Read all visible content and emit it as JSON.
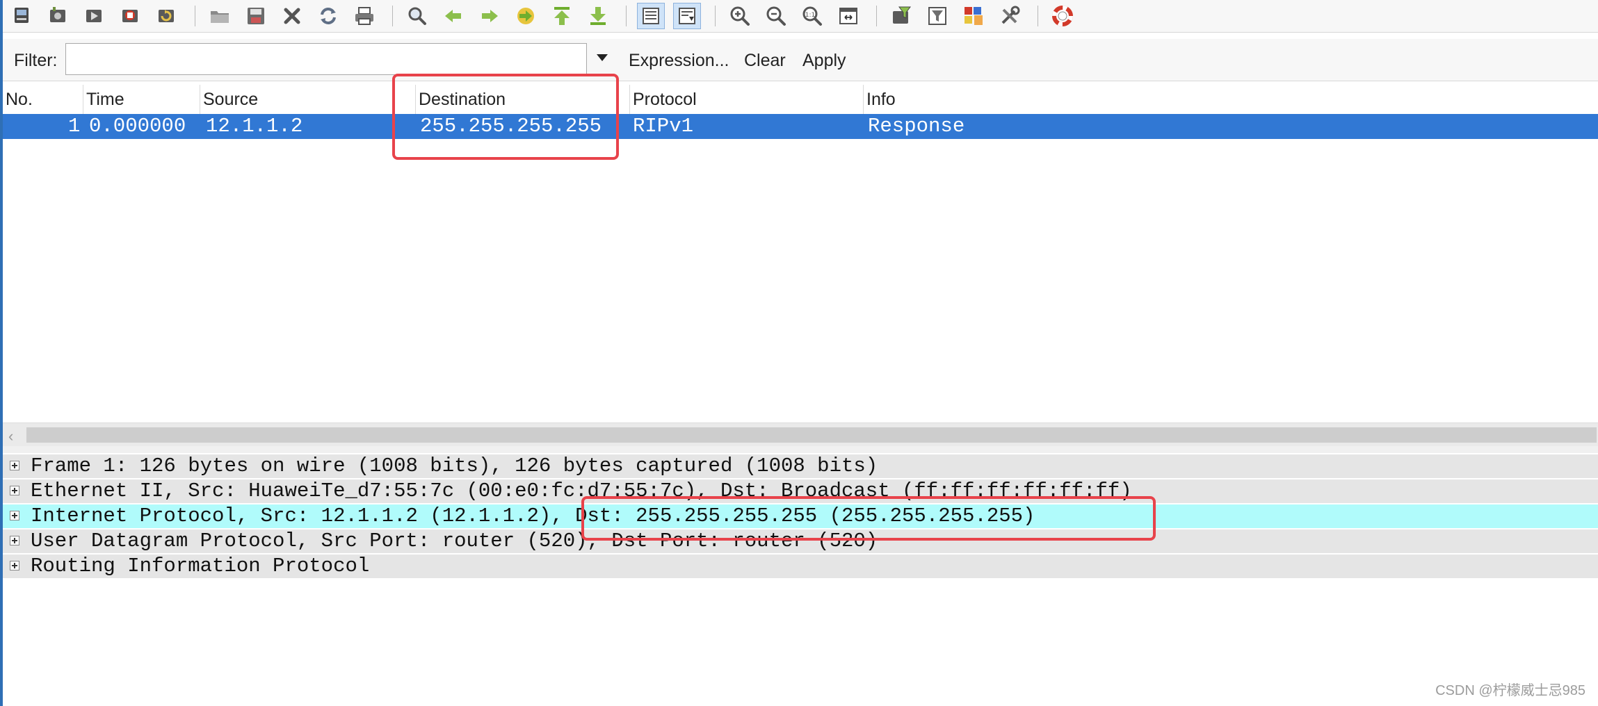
{
  "toolbar": {
    "buttons": [
      {
        "icon": "interfaces-icon"
      },
      {
        "icon": "capture-options-icon"
      },
      {
        "icon": "start-capture-icon"
      },
      {
        "icon": "stop-capture-icon"
      },
      {
        "icon": "restart-capture-icon"
      },
      {
        "icon": "open-file-icon"
      },
      {
        "icon": "save-file-icon"
      },
      {
        "icon": "close-file-icon"
      },
      {
        "icon": "reload-icon"
      },
      {
        "icon": "print-icon"
      },
      {
        "icon": "find-packet-icon"
      },
      {
        "icon": "go-back-icon"
      },
      {
        "icon": "go-forward-icon"
      },
      {
        "icon": "go-to-packet-icon"
      },
      {
        "icon": "go-first-packet-icon"
      },
      {
        "icon": "go-last-packet-icon"
      },
      {
        "icon": "colorize-icon"
      },
      {
        "icon": "auto-scroll-icon"
      },
      {
        "icon": "zoom-in-icon"
      },
      {
        "icon": "zoom-out-icon"
      },
      {
        "icon": "normal-size-icon"
      },
      {
        "icon": "resize-columns-icon"
      },
      {
        "icon": "capture-filters-icon"
      },
      {
        "icon": "display-filters-icon"
      },
      {
        "icon": "coloring-rules-icon"
      },
      {
        "icon": "preferences-icon"
      },
      {
        "icon": "help-icon"
      }
    ]
  },
  "filter": {
    "label": "Filter:",
    "value": "",
    "expression_label": "Expression...",
    "clear_label": "Clear",
    "apply_label": "Apply"
  },
  "packet_list": {
    "columns": [
      "No.",
      "Time",
      "Source",
      "Destination",
      "Protocol",
      "Info"
    ],
    "rows": [
      {
        "no": "1",
        "time": "0.000000",
        "source": "12.1.1.2",
        "destination": "255.255.255.255",
        "protocol": "RIPv1",
        "info": "Response",
        "selected": true
      }
    ]
  },
  "details": {
    "items": [
      "Frame 1: 126 bytes on wire (1008 bits), 126 bytes captured (1008 bits)",
      "Ethernet II, Src: HuaweiTe_d7:55:7c (00:e0:fc:d7:55:7c), Dst: Broadcast (ff:ff:ff:ff:ff:ff)",
      "Internet Protocol, Src: 12.1.1.2 (12.1.1.2), Dst: 255.255.255.255 (255.255.255.255)",
      "User Datagram Protocol, Src Port: router (520), Dst Port: router (520)",
      "Routing Information Protocol"
    ],
    "highlighted_index": 2
  },
  "colors": {
    "selection": "#3178d4",
    "highlight": "#b0fbfb",
    "annotation": "#e8434b"
  },
  "watermark": "CSDN @柠檬威士忌985"
}
